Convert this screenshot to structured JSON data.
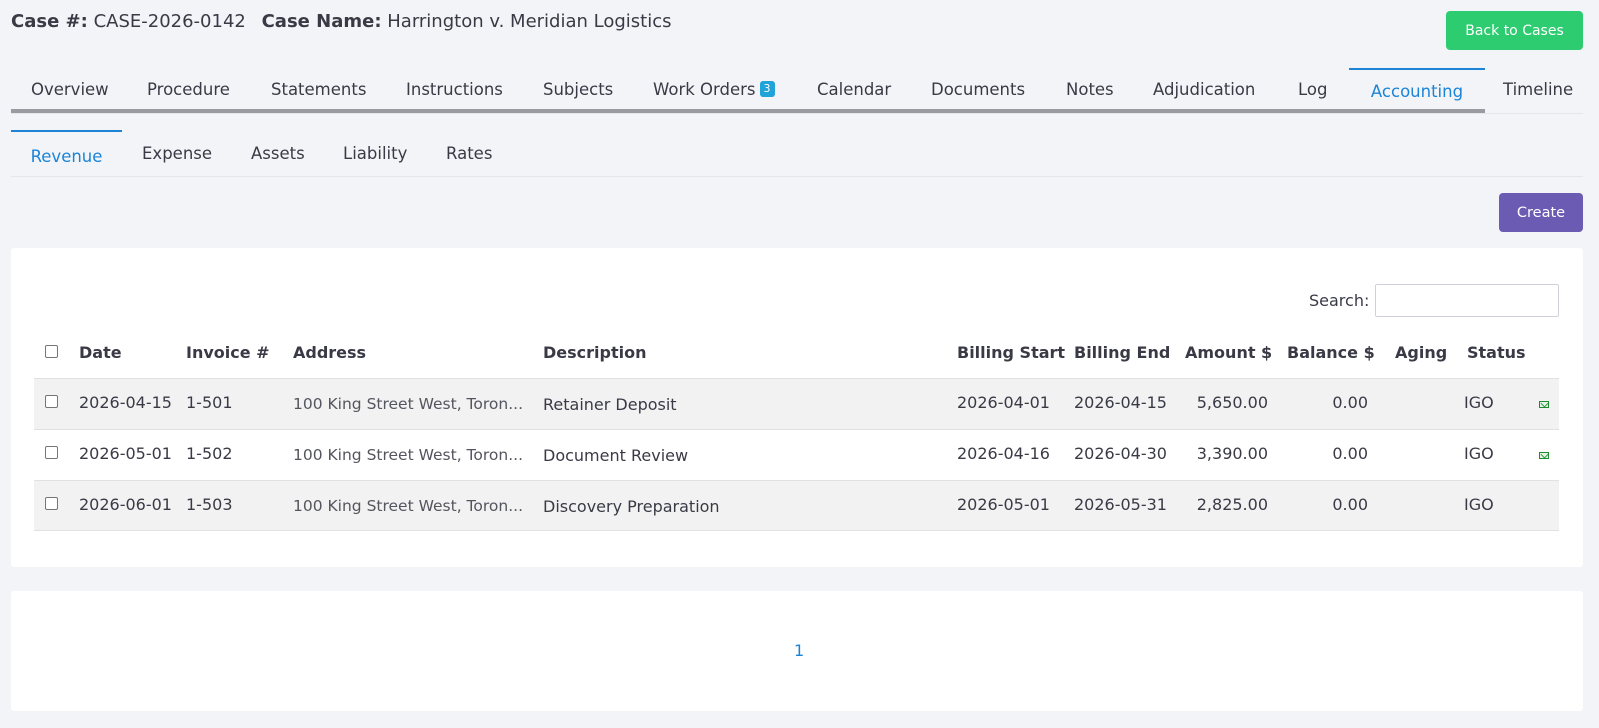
{
  "header": {
    "case_number_label": "Case #:",
    "case_number": "CASE-2026-0142",
    "case_name_label": "Case Name:",
    "case_name": "Harrington v. Meridian Logistics",
    "back_button": "Back to Cases"
  },
  "tabs": [
    {
      "label": "Overview"
    },
    {
      "label": "Procedure"
    },
    {
      "label": "Statements"
    },
    {
      "label": "Instructions"
    },
    {
      "label": "Subjects"
    },
    {
      "label": "Work Orders",
      "badge": "3"
    },
    {
      "label": "Calendar"
    },
    {
      "label": "Documents"
    },
    {
      "label": "Notes"
    },
    {
      "label": "Adjudication"
    },
    {
      "label": "Log"
    },
    {
      "label": "Accounting",
      "active": true
    },
    {
      "label": "Timeline"
    }
  ],
  "subtabs": [
    {
      "label": "Revenue",
      "active": true
    },
    {
      "label": "Expense"
    },
    {
      "label": "Assets"
    },
    {
      "label": "Liability"
    },
    {
      "label": "Rates"
    }
  ],
  "toolbar": {
    "create_label": "Create"
  },
  "search": {
    "label": "Search:",
    "value": ""
  },
  "table": {
    "headers": [
      "Date",
      "Invoice #",
      "Address",
      "Description",
      "Billing Start",
      "Billing End",
      "Amount $",
      "Balance $",
      "Aging",
      "Status"
    ],
    "rows": [
      {
        "date": "2026-04-15",
        "invoice": "1-501",
        "address": "100 King Street West, Toron...",
        "description": "Retainer Deposit",
        "billing_start": "2026-04-01",
        "billing_end": "2026-04-15",
        "amount": "5,650.00",
        "balance": "0.00",
        "aging": "",
        "status": "IGO",
        "mail_icon": true
      },
      {
        "date": "2026-05-01",
        "invoice": "1-502",
        "address": "100 King Street West, Toron...",
        "description": "Document Review",
        "billing_start": "2026-04-16",
        "billing_end": "2026-04-30",
        "amount": "3,390.00",
        "balance": "0.00",
        "aging": "",
        "status": "IGO",
        "mail_icon": true
      },
      {
        "date": "2026-06-01",
        "invoice": "1-503",
        "address": "100 King Street West, Toron...",
        "description": "Discovery Preparation",
        "billing_start": "2026-05-01",
        "billing_end": "2026-05-31",
        "amount": "2,825.00",
        "balance": "0.00",
        "aging": "",
        "status": "IGO",
        "mail_icon": false
      }
    ]
  },
  "pagination": {
    "current_page": "1"
  },
  "colors": {
    "accent": "#1b84d7",
    "back_button": "#2ecc71",
    "create_button": "#6c5bb3",
    "badge": "#1fa3d9"
  }
}
